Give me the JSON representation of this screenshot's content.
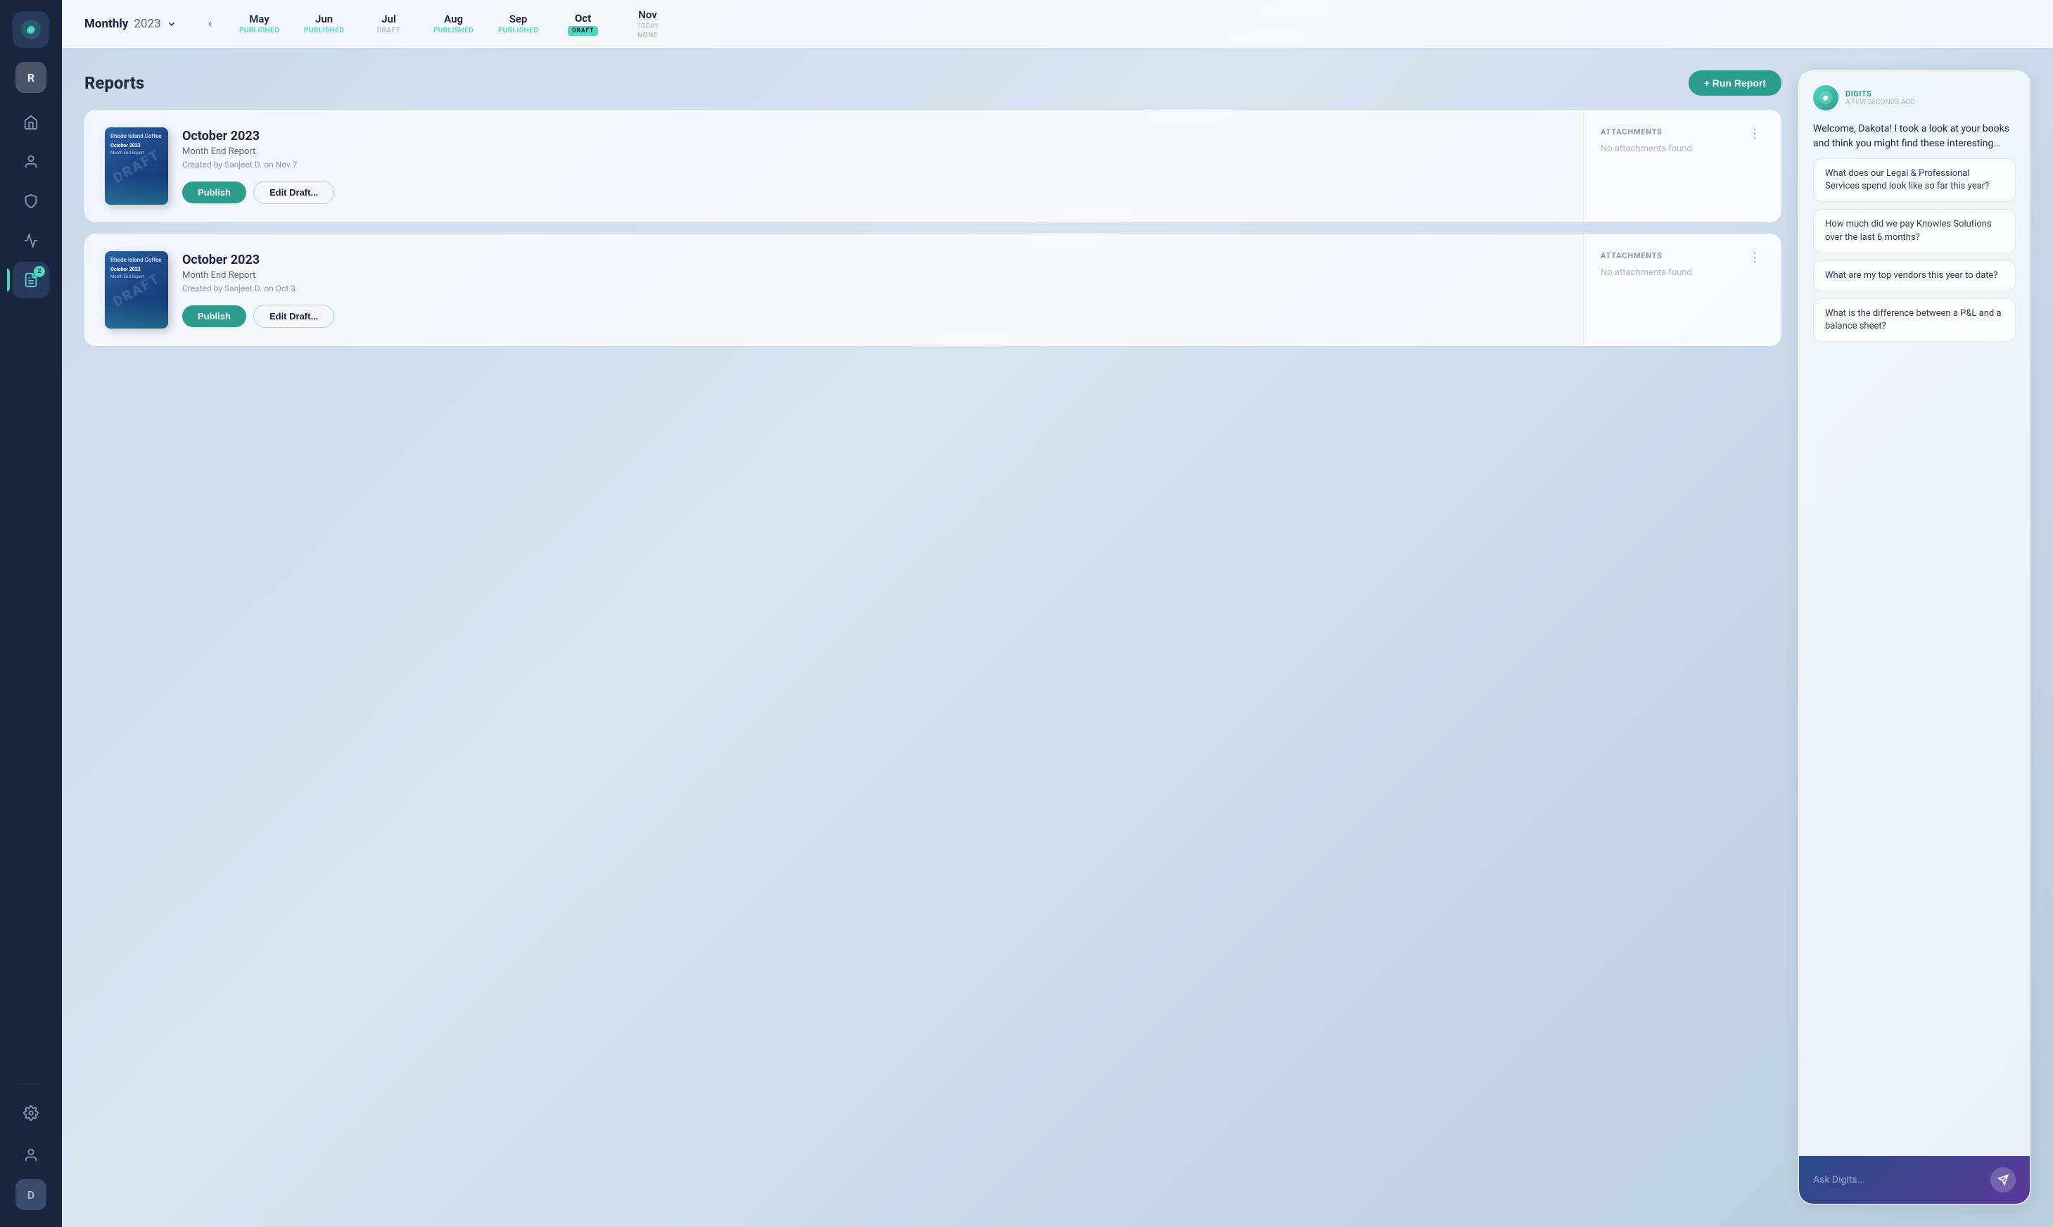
{
  "sidebar": {
    "logo_label": "Digits",
    "top_avatar": "R",
    "nav_items": [
      {
        "id": "home",
        "icon": "home-icon",
        "active": false
      },
      {
        "id": "user",
        "icon": "user-icon",
        "active": false
      },
      {
        "id": "shield",
        "icon": "shield-icon",
        "active": false
      },
      {
        "id": "activity",
        "icon": "activity-icon",
        "active": false
      },
      {
        "id": "reports",
        "icon": "reports-icon",
        "active": true,
        "badge": "2"
      }
    ],
    "bottom_items": [
      {
        "id": "settings",
        "icon": "gear-icon"
      },
      {
        "id": "profile",
        "icon": "person-icon"
      }
    ],
    "bottom_avatar": "D"
  },
  "timeline": {
    "period": "Monthly",
    "year": "2023",
    "months": [
      {
        "name": "May",
        "status": "PUBLISHED",
        "type": "published"
      },
      {
        "name": "Jun",
        "status": "PUBLISHED",
        "type": "published"
      },
      {
        "name": "Jul",
        "status": "DRAFT",
        "type": "draft"
      },
      {
        "name": "Aug",
        "status": "PUBLISHED",
        "type": "published"
      },
      {
        "name": "Sep",
        "status": "PUBLISHED",
        "type": "published"
      },
      {
        "name": "Oct",
        "status": "DRAFT",
        "type": "draft",
        "active": true,
        "badge": "DRAFT"
      },
      {
        "name": "Nov",
        "status": "NONE",
        "type": "none",
        "today": "TODAY"
      }
    ]
  },
  "reports": {
    "title": "Reports",
    "run_report_btn": "+ Run Report",
    "cards": [
      {
        "id": "report-1",
        "title": "October 2023",
        "type": "Month End Report",
        "created": "Created by Sanjeet D. on Nov 7",
        "publish_label": "Publish",
        "edit_label": "Edit Draft...",
        "attachments_label": "ATTACHMENTS",
        "no_attachments": "No attachments found",
        "thumbnail_company": "Rhode Island Coffee",
        "thumbnail_title": "October 2023",
        "thumbnail_sub": "Month End Report"
      },
      {
        "id": "report-2",
        "title": "October 2023",
        "type": "Month End Report",
        "created": "Created by Sanjeet D. on Oct 3",
        "publish_label": "Publish",
        "edit_label": "Edit Draft...",
        "attachments_label": "ATTACHMENTS",
        "no_attachments": "No attachments found",
        "thumbnail_company": "Rhode Island Coffee",
        "thumbnail_title": "October 2023",
        "thumbnail_sub": "Month End Report"
      }
    ]
  },
  "chat": {
    "sender": "DIGITS",
    "time": "A FEW SECONDS AGO",
    "welcome_message": "Welcome, Dakota! I took a look at your books and think you might find these interesting...",
    "suggestions": [
      "What does our Legal & Professional Services spend look like so far this year?",
      "How much did we pay Knowles Solutions over the last 6 months?",
      "What are my top vendors this year to date?",
      "What is the difference between a P&L and a balance sheet?"
    ],
    "input_placeholder": "Ask Digits..."
  }
}
